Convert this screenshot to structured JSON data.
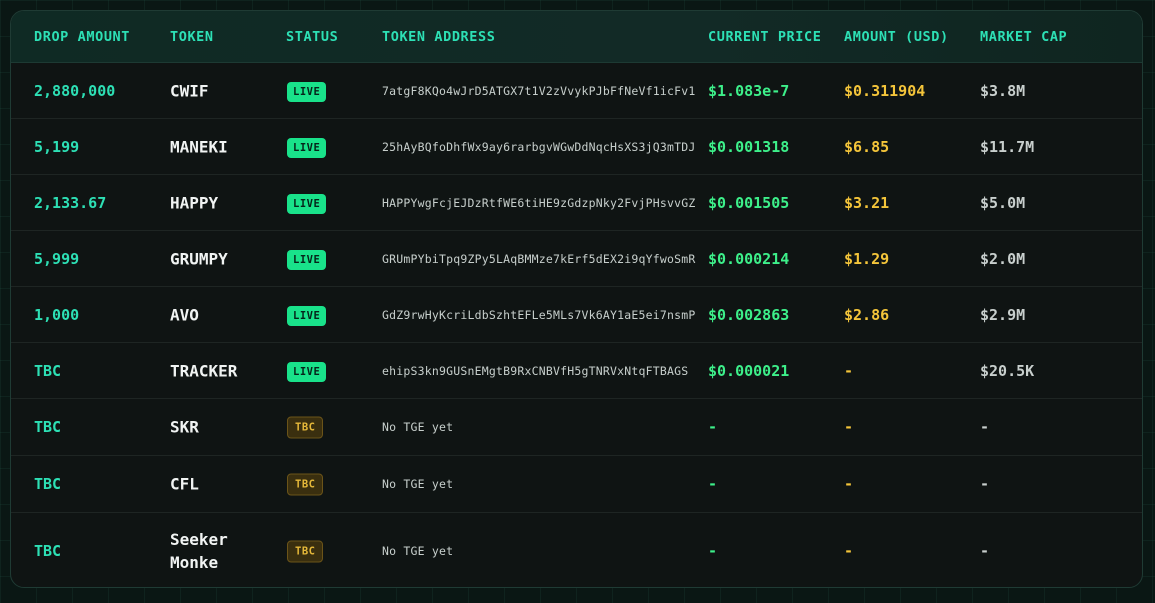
{
  "columns": {
    "drop_amount": "DROP AMOUNT",
    "token": "TOKEN",
    "status": "STATUS",
    "token_address": "TOKEN ADDRESS",
    "current_price": "CURRENT PRICE",
    "amount_usd": "AMOUNT (USD)",
    "market_cap": "MARKET CAP"
  },
  "colors": {
    "accent": "#2de0b5",
    "price": "#3df08a",
    "usd": "#f4c53a",
    "live_badge": "#19e28a",
    "tbc_badge": "#e6b93a"
  },
  "rows": [
    {
      "drop": "2,880,000",
      "token": "CWIF",
      "status": "LIVE",
      "address": "7atgF8KQo4wJrD5ATGX7t1V2zVvykPJbFfNeVf1icFv1",
      "price": "$1.083e-7",
      "usd": "$0.311904",
      "cap": "$3.8M"
    },
    {
      "drop": "5,199",
      "token": "MANEKI",
      "status": "LIVE",
      "address": "25hAyBQfoDhfWx9ay6rarbgvWGwDdNqcHsXS3jQ3mTDJ",
      "price": "$0.001318",
      "usd": "$6.85",
      "cap": "$11.7M"
    },
    {
      "drop": "2,133.67",
      "token": "HAPPY",
      "status": "LIVE",
      "address": "HAPPYwgFcjEJDzRtfWE6tiHE9zGdzpNky2FvjPHsvvGZ",
      "price": "$0.001505",
      "usd": "$3.21",
      "cap": "$5.0M"
    },
    {
      "drop": "5,999",
      "token": "GRUMPY",
      "status": "LIVE",
      "address": "GRUmPYbiTpq9ZPy5LAqBMMze7kErf5dEX2i9qYfwoSmR",
      "price": "$0.000214",
      "usd": "$1.29",
      "cap": "$2.0M"
    },
    {
      "drop": "1,000",
      "token": "AVO",
      "status": "LIVE",
      "address": "GdZ9rwHyKcriLdbSzhtEFLe5MLs7Vk6AY1aE5ei7nsmP",
      "price": "$0.002863",
      "usd": "$2.86",
      "cap": "$2.9M"
    },
    {
      "drop": "TBC",
      "token": "TRACKER",
      "status": "LIVE",
      "address": "ehipS3kn9GUSnEMgtB9RxCNBVfH5gTNRVxNtqFTBAGS",
      "price": "$0.000021",
      "usd": "-",
      "cap": "$20.5K"
    },
    {
      "drop": "TBC",
      "token": "SKR",
      "status": "TBC",
      "address": "No TGE yet",
      "price": "-",
      "usd": "-",
      "cap": "-"
    },
    {
      "drop": "TBC",
      "token": "CFL",
      "status": "TBC",
      "address": "No TGE yet",
      "price": "-",
      "usd": "-",
      "cap": "-"
    },
    {
      "drop": "TBC",
      "token": "Seeker Monke",
      "status": "TBC",
      "address": "No TGE yet",
      "price": "-",
      "usd": "-",
      "cap": "-"
    }
  ]
}
